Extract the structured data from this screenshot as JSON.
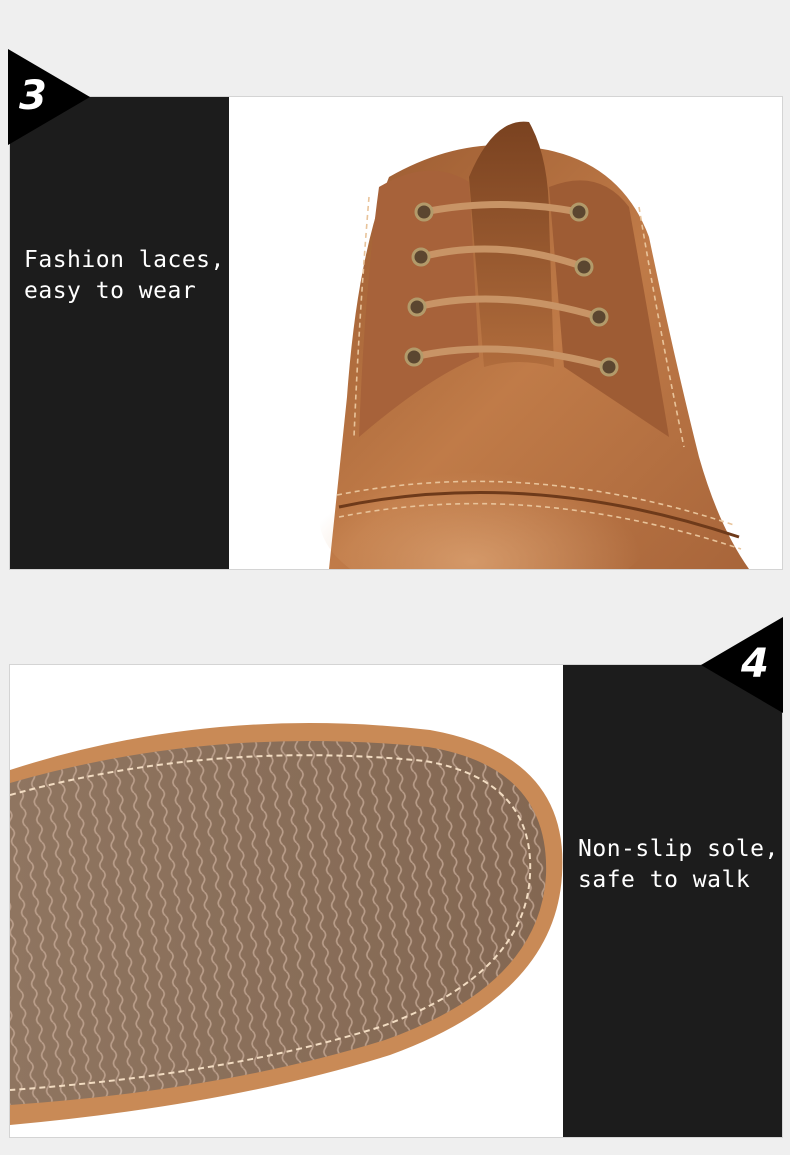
{
  "sections": [
    {
      "number": "3",
      "caption_lines": [
        "Fashion laces,",
        "easy to wear"
      ],
      "image": "brown-leather-shoe-laces-closeup"
    },
    {
      "number": "4",
      "caption_lines": [
        "Non-slip sole,",
        "safe to walk"
      ],
      "image": "rubber-outsole-closeup"
    }
  ],
  "colors": {
    "page_background": "#efefef",
    "text_panel": "#1c1c1c",
    "caption_text": "#ffffff",
    "badge": "#000000",
    "leather": "#b36c3c",
    "sole": "#8c7058"
  }
}
